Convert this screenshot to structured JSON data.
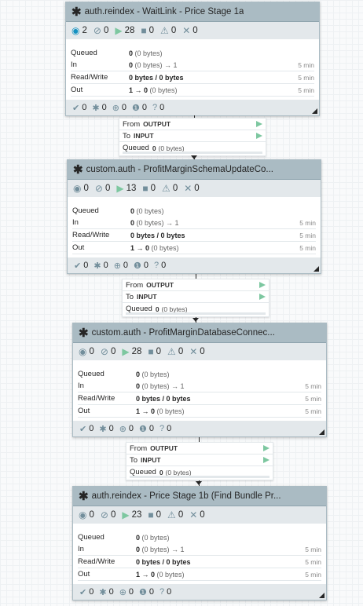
{
  "processors": [
    {
      "name": "auth.reindex - WaitLink - Price Stage 1a",
      "stats": {
        "transmitting": "2",
        "not_transmitting": "0",
        "running": "28",
        "stopped": "0",
        "invalid": "0",
        "disabled": "0"
      },
      "queued_label": "Queued",
      "queued_value": "0",
      "queued_sub": "(0 bytes)",
      "in_label": "In",
      "in_value": "0",
      "in_sub": "(0 bytes) → 1",
      "in_time": "5 min",
      "rw_label": "Read/Write",
      "rw_value": "0 bytes / 0 bytes",
      "rw_time": "5 min",
      "out_label": "Out",
      "out_value": "1 → 0",
      "out_sub": "(0 bytes)",
      "out_time": "5 min",
      "footer": {
        "up_to_date": "0",
        "locally_modified": "0",
        "stale": "0",
        "sync_failure": "0",
        "unknown": "0"
      }
    },
    {
      "name": "custom.auth - ProfitMarginSchemaUpdateCo...",
      "stats": {
        "transmitting": "0",
        "not_transmitting": "0",
        "running": "13",
        "stopped": "0",
        "invalid": "0",
        "disabled": "0"
      },
      "queued_label": "Queued",
      "queued_value": "0",
      "queued_sub": "(0 bytes)",
      "in_label": "In",
      "in_value": "0",
      "in_sub": "(0 bytes) → 1",
      "in_time": "5 min",
      "rw_label": "Read/Write",
      "rw_value": "0 bytes / 0 bytes",
      "rw_time": "5 min",
      "out_label": "Out",
      "out_value": "1 → 0",
      "out_sub": "(0 bytes)",
      "out_time": "5 min",
      "footer": {
        "up_to_date": "0",
        "locally_modified": "0",
        "stale": "0",
        "sync_failure": "0",
        "unknown": "0"
      }
    },
    {
      "name": "custom.auth - ProfitMarginDatabaseConnec...",
      "stats": {
        "transmitting": "0",
        "not_transmitting": "0",
        "running": "28",
        "stopped": "0",
        "invalid": "0",
        "disabled": "0"
      },
      "queued_label": "Queued",
      "queued_value": "0",
      "queued_sub": "(0 bytes)",
      "in_label": "In",
      "in_value": "0",
      "in_sub": "(0 bytes) → 1",
      "in_time": "5 min",
      "rw_label": "Read/Write",
      "rw_value": "0 bytes / 0 bytes",
      "rw_time": "5 min",
      "out_label": "Out",
      "out_value": "1 → 0",
      "out_sub": "(0 bytes)",
      "out_time": "5 min",
      "footer": {
        "up_to_date": "0",
        "locally_modified": "0",
        "stale": "0",
        "sync_failure": "0",
        "unknown": "0"
      }
    },
    {
      "name": "auth.reindex - Price Stage 1b (Find Bundle Pr...",
      "stats": {
        "transmitting": "0",
        "not_transmitting": "0",
        "running": "23",
        "stopped": "0",
        "invalid": "0",
        "disabled": "0"
      },
      "queued_label": "Queued",
      "queued_value": "0",
      "queued_sub": "(0 bytes)",
      "in_label": "In",
      "in_value": "0",
      "in_sub": "(0 bytes) → 1",
      "in_time": "5 min",
      "rw_label": "Read/Write",
      "rw_value": "0 bytes / 0 bytes",
      "rw_time": "5 min",
      "out_label": "Out",
      "out_value": "1 → 0",
      "out_sub": "(0 bytes)",
      "out_time": "5 min",
      "footer": {
        "up_to_date": "0",
        "locally_modified": "0",
        "stale": "0",
        "sync_failure": "0",
        "unknown": "0"
      }
    }
  ],
  "connections": [
    {
      "from_label": "From",
      "from_value": "OUTPUT",
      "to_label": "To",
      "to_value": "INPUT",
      "queued_label": "Queued",
      "queued_value": "0",
      "queued_sub": "(0 bytes)"
    },
    {
      "from_label": "From",
      "from_value": "OUTPUT",
      "to_label": "To",
      "to_value": "INPUT",
      "queued_label": "Queued",
      "queued_value": "0",
      "queued_sub": "(0 bytes)"
    },
    {
      "from_label": "From",
      "from_value": "OUTPUT",
      "to_label": "To",
      "to_value": "INPUT",
      "queued_label": "Queued",
      "queued_value": "0",
      "queued_sub": "(0 bytes)"
    }
  ],
  "icons": {
    "processor": "gear-icon",
    "transmitting": "transmitting-icon",
    "not_transmitting": "not-transmitting-icon",
    "running": "play-icon",
    "stopped": "stop-icon",
    "invalid": "warning-icon",
    "disabled": "disabled-icon",
    "up_to_date": "check-icon",
    "locally_modified": "asterisk-icon",
    "stale": "up-arrow-icon",
    "sync_failure": "exclamation-icon",
    "unknown": "question-icon",
    "expected_arrow": "play-arrow-icon"
  },
  "colors": {
    "header_bg": "#aabbc3",
    "stats_bg": "#e3e8eb",
    "running": "#7dc7a0",
    "transmitting": "#1491c1"
  }
}
